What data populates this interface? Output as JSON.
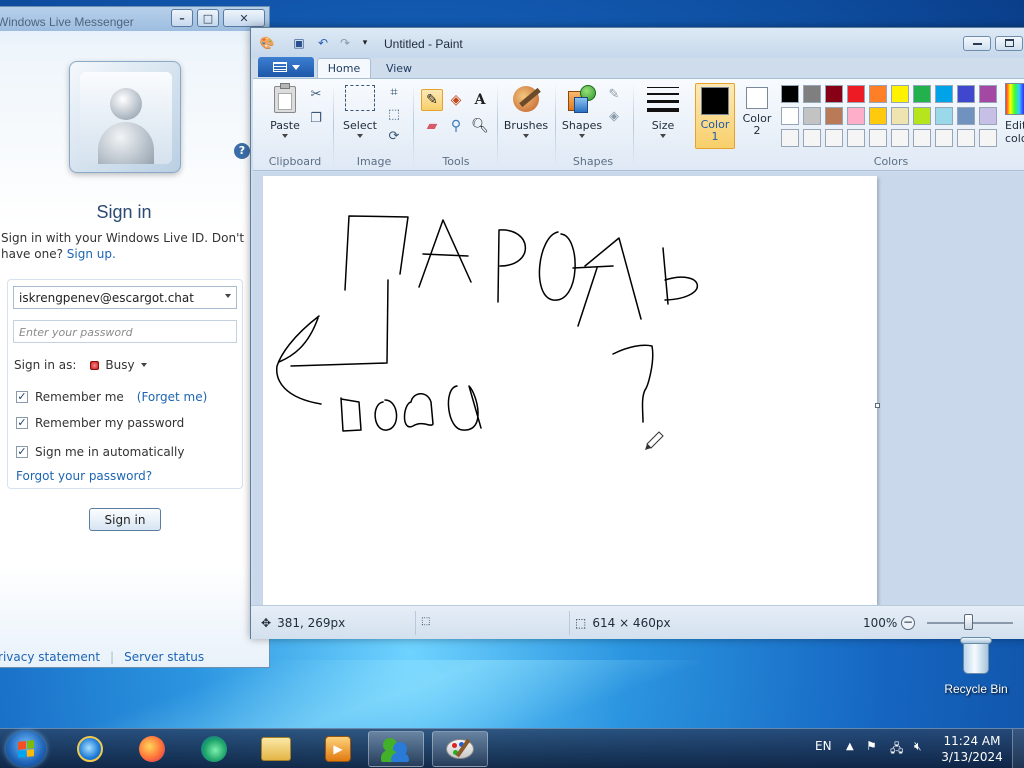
{
  "messenger": {
    "title": "Windows Live Messenger",
    "signin_title": "Sign in",
    "desc_text": "Sign in with your Windows Live ID. Don't have one?",
    "signup_link": "Sign up.",
    "email": "iskrengpenev@escargot.chat",
    "password_placeholder": "Enter your password",
    "sign_in_as_label": "Sign in as:",
    "status": "Busy",
    "remember_me": "Remember me",
    "forget_me": "(Forget me)",
    "remember_password": "Remember my password",
    "sign_in_auto": "Sign me in automatically",
    "forgot_password": "Forgot your password?",
    "signin_button": "Sign in",
    "privacy": "Privacy statement",
    "server_status": "Server status"
  },
  "paint": {
    "title": "Untitled - Paint",
    "tabs": [
      "Home",
      "View"
    ],
    "groups": {
      "clipboard": "Clipboard",
      "image": "Image",
      "tools": "Tools",
      "shapes": "Shapes",
      "colors": "Colors"
    },
    "buttons": {
      "paste": "Paste",
      "select": "Select",
      "brushes": "Brushes",
      "shapes": "Shapes",
      "size": "Size",
      "color1_line1": "Color",
      "color1_line2": "1",
      "color2_line1": "Color",
      "color2_line2": "2",
      "edit_line1": "Edit",
      "edit_line2": "colors"
    },
    "color1": "#000000",
    "color2": "#ffffff",
    "palette": [
      "#000000",
      "#7f7f7f",
      "#880015",
      "#ed1c24",
      "#ff7f27",
      "#fff200",
      "#22b14c",
      "#00a2e8",
      "#3f48cc",
      "#a349a4",
      "#ffffff",
      "#c3c3c3",
      "#b97a57",
      "#ffaec9",
      "#ffc90e",
      "#efe4b0",
      "#b5e61d",
      "#99d9ea",
      "#7092be",
      "#c8bfe7",
      "#f5f5f5",
      "#f5f5f5",
      "#f5f5f5",
      "#f5f5f5",
      "#f5f5f5",
      "#f5f5f5",
      "#f5f5f5",
      "#f5f5f5",
      "#f5f5f5",
      "#f5f5f5"
    ],
    "status": {
      "cursor_pos": "381, 269px",
      "canvas_size": "614 × 460px",
      "zoom": "100%"
    }
  },
  "desktop": {
    "recycle_bin": "Recycle Bin"
  },
  "taskbar": {
    "lang": "EN",
    "time": "11:24 AM",
    "date": "3/13/2024"
  }
}
